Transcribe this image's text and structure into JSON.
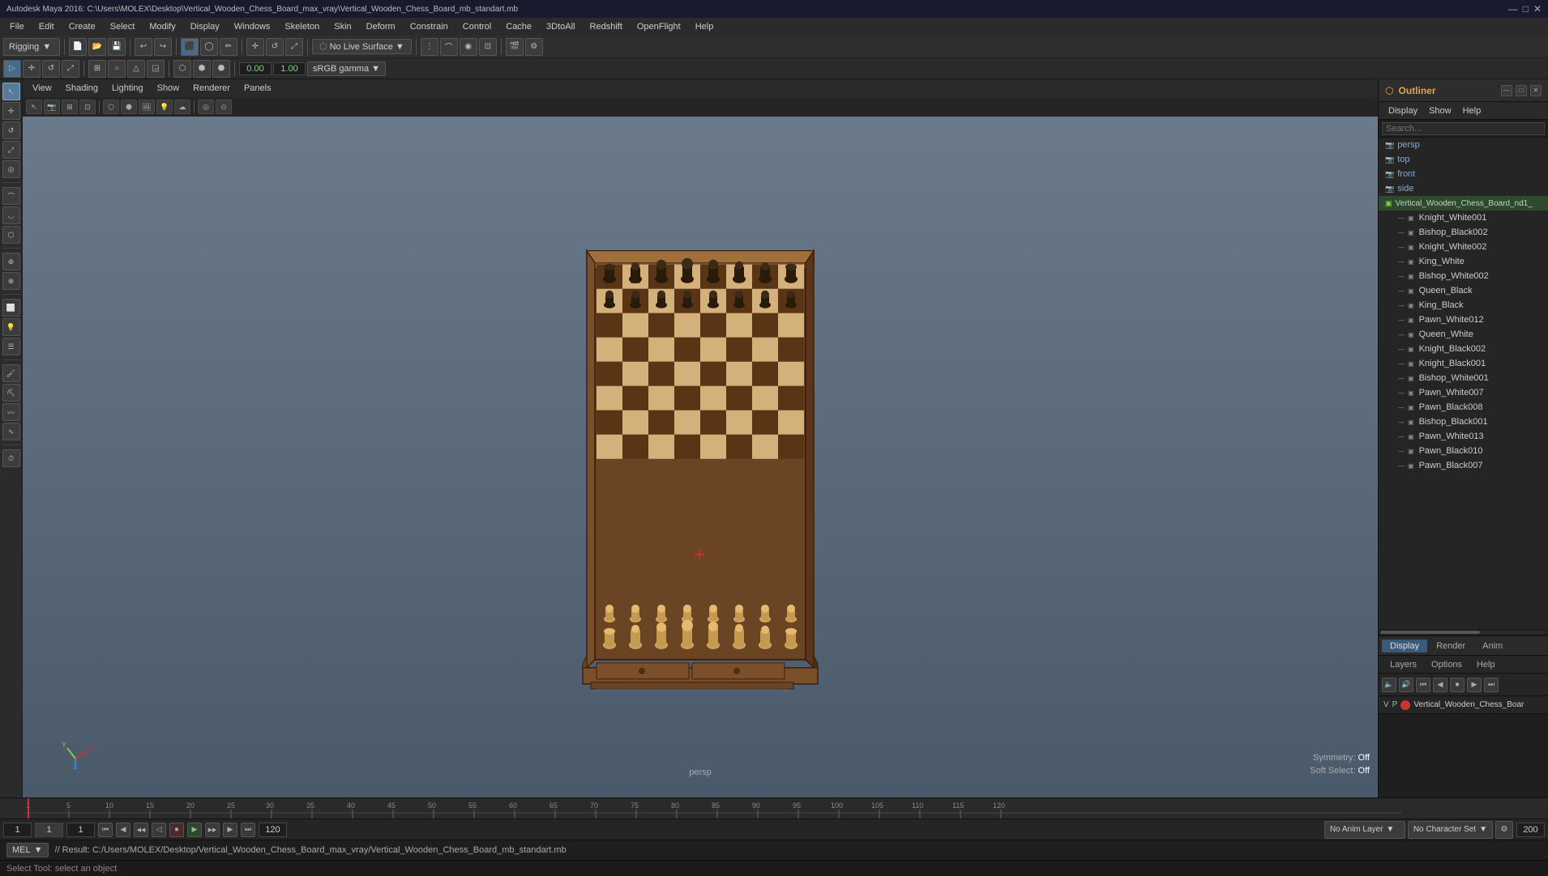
{
  "titlebar": {
    "title": "Autodesk Maya 2016: C:\\Users\\MOLEX\\Desktop\\Vertical_Wooden_Chess_Board_max_vray\\Vertical_Wooden_Chess_Board_mb_standart.mb",
    "minimize": "—",
    "maximize": "□",
    "close": "✕"
  },
  "menubar": {
    "items": [
      "File",
      "Edit",
      "Create",
      "Select",
      "Modify",
      "Display",
      "Windows",
      "Skeleton",
      "Skin",
      "Deform",
      "Constrain",
      "Control",
      "Cache",
      "3DtoAll",
      "Redshift",
      "OpenFlight",
      "Help"
    ]
  },
  "toolbar1": {
    "mode_dropdown": "Rigging",
    "no_live_surface": "No Live Surface"
  },
  "viewport": {
    "menu_items": [
      "View",
      "Shading",
      "Lighting",
      "Show",
      "Renderer",
      "Panels"
    ],
    "persp_label": "persp",
    "symmetry_label": "Symmetry:",
    "symmetry_value": "Off",
    "soft_select_label": "Soft Select:",
    "soft_select_value": "Off",
    "color_space": "sRGB gamma",
    "val1": "0.00",
    "val2": "1.00"
  },
  "outliner": {
    "title": "Outliner",
    "menu_items": [
      "Display",
      "Show",
      "Help"
    ],
    "cameras": [
      {
        "name": "persp",
        "type": "camera"
      },
      {
        "name": "top",
        "type": "camera"
      },
      {
        "name": "front",
        "type": "camera"
      },
      {
        "name": "side",
        "type": "camera"
      }
    ],
    "objects": [
      {
        "name": "Vertical_Wooden_Chess_Board_nd1_",
        "type": "group",
        "indent": 0
      },
      {
        "name": "Knight_White001",
        "type": "mesh",
        "indent": 1
      },
      {
        "name": "Bishop_Black002",
        "type": "mesh",
        "indent": 1
      },
      {
        "name": "Knight_White002",
        "type": "mesh",
        "indent": 1
      },
      {
        "name": "King_White",
        "type": "mesh",
        "indent": 1
      },
      {
        "name": "Bishop_White002",
        "type": "mesh",
        "indent": 1
      },
      {
        "name": "Queen_Black",
        "type": "mesh",
        "indent": 1
      },
      {
        "name": "King_Black",
        "type": "mesh",
        "indent": 1
      },
      {
        "name": "Pawn_White012",
        "type": "mesh",
        "indent": 1
      },
      {
        "name": "Queen_White",
        "type": "mesh",
        "indent": 1
      },
      {
        "name": "Knight_Black002",
        "type": "mesh",
        "indent": 1
      },
      {
        "name": "Knight_Black001",
        "type": "mesh",
        "indent": 1
      },
      {
        "name": "Bishop_White001",
        "type": "mesh",
        "indent": 1
      },
      {
        "name": "Pawn_White007",
        "type": "mesh",
        "indent": 1
      },
      {
        "name": "Pawn_Black008",
        "type": "mesh",
        "indent": 1
      },
      {
        "name": "Bishop_Black001",
        "type": "mesh",
        "indent": 1
      },
      {
        "name": "Pawn_White013",
        "type": "mesh",
        "indent": 1
      },
      {
        "name": "Pawn_Black010",
        "type": "mesh",
        "indent": 1
      },
      {
        "name": "Pawn_Black007",
        "type": "mesh",
        "indent": 1
      }
    ]
  },
  "right_bottom": {
    "tabs": [
      "Display",
      "Render",
      "Anim"
    ],
    "active_tab": "Display",
    "subtabs": [
      "Layers",
      "Options",
      "Help"
    ],
    "layer_v": "V",
    "layer_p": "P",
    "layer_name": "Vertical_Wooden_Chess_Boar"
  },
  "timeline": {
    "start_frame": "1",
    "current_frame": "1",
    "range_start": "1",
    "range_end": "120",
    "end_frame": "120",
    "max_frame": "200",
    "anim_layer": "No Anim Layer",
    "char_set": "No Character Set",
    "ticks": [
      1,
      5,
      10,
      15,
      20,
      25,
      30,
      35,
      40,
      45,
      50,
      55,
      60,
      65,
      70,
      75,
      80,
      85,
      90,
      95,
      100,
      105,
      110,
      115,
      120
    ]
  },
  "statusbar": {
    "mode": "MEL",
    "result_text": "// Result: C:/Users/MOLEX/Desktop/Vertical_Wooden_Chess_Board_max_vray/Vertical_Wooden_Chess_Board_mb_standart.mb",
    "help_text": "Select Tool: select an object"
  },
  "icons": {
    "camera": "📷",
    "mesh": "⬜",
    "group": "📁",
    "play": "▶",
    "rewind": "⏮",
    "step_back": "◀",
    "step_forward": "▶",
    "fast_forward": "⏭",
    "record": "⏺"
  }
}
